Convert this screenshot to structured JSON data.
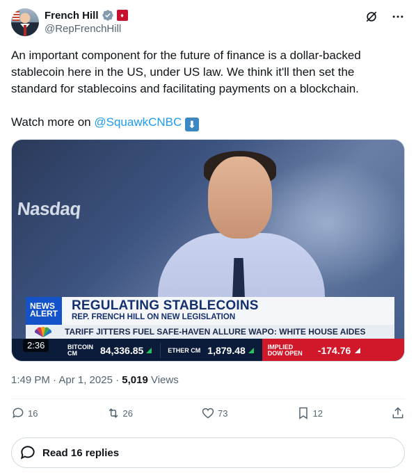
{
  "author": {
    "display_name": "French Hill",
    "handle": "@RepFrenchHill",
    "avatar_icon": "avatar-photo",
    "verified_icon": "verified-badge-icon",
    "affiliation_icon": "us-house-badge-icon"
  },
  "top_actions": {
    "grok_icon": "grok-icon",
    "more_icon": "more-dots-icon"
  },
  "tweet": {
    "text_line1": "An important component for the future of finance is a dollar-backed stablecoin here in the US, under US law. We think it'll then set the standard for stablecoins and facilitating payments on a blockchain.",
    "watch_prefix": "Watch more on ",
    "mention": "@SquawkCNBC",
    "arrow_emoji": "⬇"
  },
  "media": {
    "background_brand": "Nasdaq",
    "alert_badge_line1": "NEWS",
    "alert_badge_line2": "ALERT",
    "headline": "REGULATING STABLECOINS",
    "subheadline": "REP. FRENCH HILL ON NEW LEGISLATION",
    "ticker_top": "TARIFF JITTERS FUEL SAFE-HAVEN ALLURE    WAPO:  WHITE HOUSE AIDES",
    "ticker_items": {
      "bitcoin_label_1": "BITCOIN",
      "bitcoin_label_2": "CM",
      "bitcoin_value": "84,336.85",
      "ether_label": "ETHER CM",
      "ether_value": "1,879.48",
      "dow_label_1": "IMPLIED",
      "dow_label_2": "DOW OPEN",
      "dow_value": "-174.76"
    },
    "network_logo": "CNBC",
    "duration": "2:36"
  },
  "meta": {
    "timestamp": "1:49 PM · Apr 1, 2025",
    "separator": " · ",
    "views_count": "5,019",
    "views_label": " Views"
  },
  "actions": {
    "replies": "16",
    "reposts": "26",
    "likes": "73",
    "bookmarks": "12"
  },
  "read_replies": {
    "label": "Read 16 replies"
  },
  "colors": {
    "accent": "#1d9bf0",
    "text": "#0f1419",
    "muted": "#536471"
  }
}
